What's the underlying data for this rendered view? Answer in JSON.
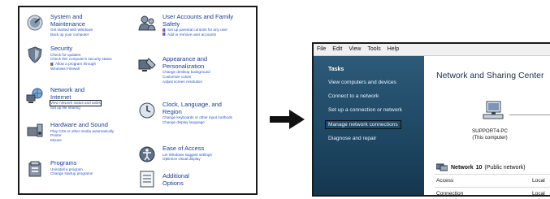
{
  "control_panel": {
    "left_categories": [
      {
        "title": "System and Maintenance",
        "subs": [
          "Get started with Windows",
          "Back up your computer"
        ],
        "icon": "system-maintenance-icon"
      },
      {
        "title": "Security",
        "subs": [
          "Check for updates",
          "Check this computer's security status",
          "Allow a program through Windows Firewall"
        ],
        "icon": "security-shield-icon"
      },
      {
        "title": "Network and Internet",
        "subs": [
          "View network status and tasks",
          "Set up file sharing"
        ],
        "icon": "network-internet-icon"
      },
      {
        "title": "Hardware and Sound",
        "subs": [
          "Play CDs or other media automatically",
          "Printer",
          "Mouse"
        ],
        "icon": "hardware-sound-icon"
      },
      {
        "title": "Programs",
        "subs": [
          "Uninstall a program",
          "Change startup programs"
        ],
        "icon": "programs-icon"
      }
    ],
    "right_categories": [
      {
        "title": "User Accounts and Family Safety",
        "subs": [
          "Set up parental controls for any user",
          "Add or remove user accounts"
        ],
        "icon": "user-accounts-icon"
      },
      {
        "title": "Appearance and Personalization",
        "subs": [
          "Change desktop background",
          "Customize colors",
          "Adjust screen resolution"
        ],
        "icon": "appearance-icon"
      },
      {
        "title": "Clock, Language, and Region",
        "subs": [
          "Change keyboards or other input methods",
          "Change display language"
        ],
        "icon": "clock-globe-icon"
      },
      {
        "title": "Ease of Access",
        "subs": [
          "Let Windows suggest settings",
          "Optimize visual display"
        ],
        "icon": "ease-of-access-icon"
      },
      {
        "title": "Additional Options",
        "subs": [],
        "icon": "additional-options-icon"
      }
    ]
  },
  "network_window": {
    "menu": [
      "File",
      "Edit",
      "View",
      "Tools",
      "Help"
    ],
    "tasks_heading": "Tasks",
    "tasks": [
      "View computers and devices",
      "Connect to a network",
      "Set up a connection or network",
      "Manage network connections",
      "Diagnose and repair"
    ],
    "title": "Network and Sharing Center",
    "computer_name": "SUPPORT4-PC",
    "computer_sub": "(This computer)",
    "network_name": "Network",
    "network_num": "10",
    "network_type": "(Public network)",
    "rows": [
      {
        "key": "Access",
        "value": "Local"
      },
      {
        "key": "Connection",
        "value": "Local"
      }
    ]
  },
  "colors": {
    "link": "#2a54c0",
    "title": "#1d3d8f",
    "sidebar": "#1d4662"
  }
}
